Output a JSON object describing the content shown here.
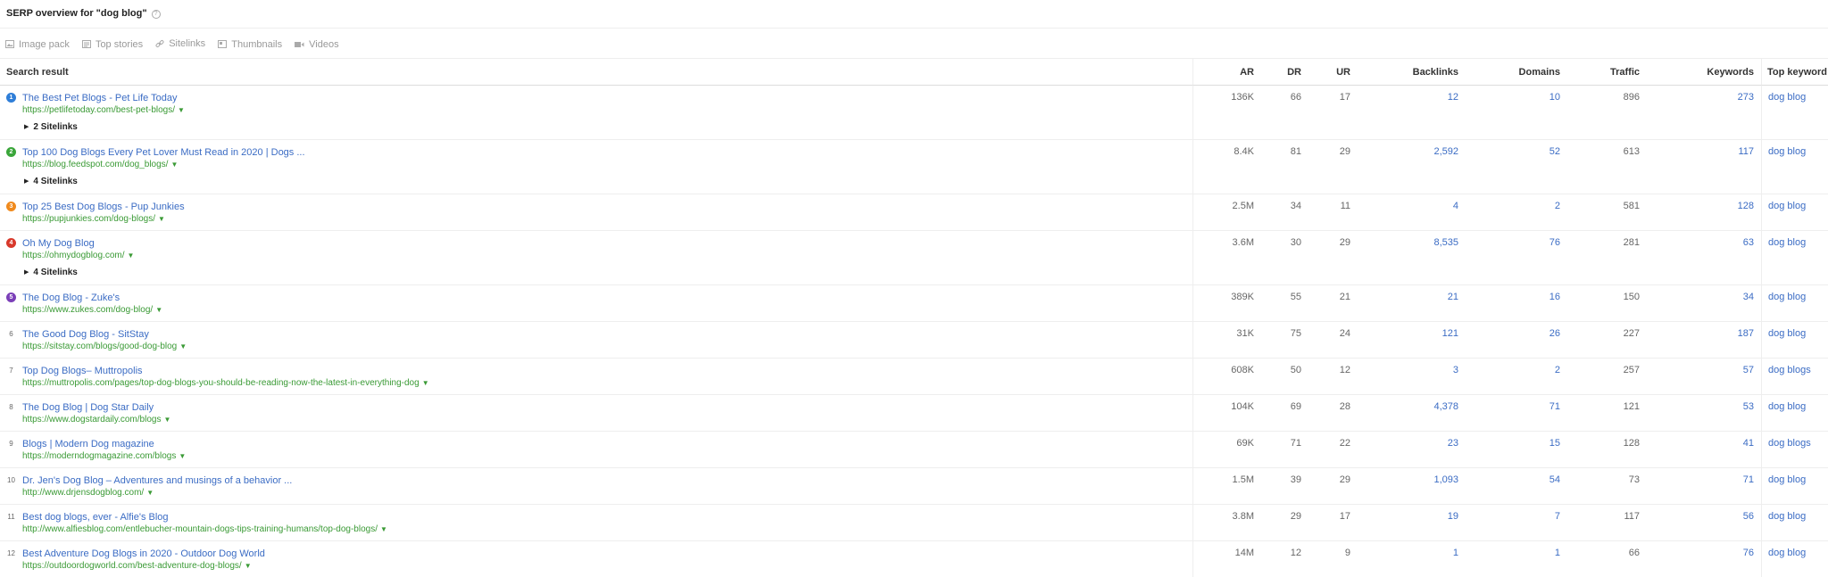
{
  "header": {
    "title": "SERP overview for \"dog blog\"",
    "help_glyph": "?"
  },
  "features": [
    {
      "label": "Image pack",
      "icon": "image-icon"
    },
    {
      "label": "Top stories",
      "icon": "news-icon"
    },
    {
      "label": "Sitelinks",
      "icon": "link-icon"
    },
    {
      "label": "Thumbnails",
      "icon": "thumbnail-icon"
    },
    {
      "label": "Videos",
      "icon": "video-icon"
    }
  ],
  "columns": {
    "result": "Search result",
    "ar": "AR",
    "dr": "DR",
    "ur": "UR",
    "backlinks": "Backlinks",
    "domains": "Domains",
    "traffic": "Traffic",
    "keywords": "Keywords",
    "top_keyword": "Top keyword"
  },
  "rows": [
    {
      "pos": "1",
      "badge_color": "#2f7ed8",
      "title": "The Best Pet Blogs - Pet Life Today",
      "url": "https://petlifetoday.com/best-pet-blogs/",
      "sitelinks": "2 Sitelinks",
      "ar": "136K",
      "dr": "66",
      "ur": "17",
      "backlinks": "12",
      "domains": "10",
      "traffic": "896",
      "keywords": "273",
      "top_keyword": "dog blog"
    },
    {
      "pos": "2",
      "badge_color": "#3aa63a",
      "title": "Top 100 Dog Blogs Every Pet Lover Must Read in 2020 | Dogs ...",
      "url": "https://blog.feedspot.com/dog_blogs/",
      "sitelinks": "4 Sitelinks",
      "ar": "8.4K",
      "dr": "81",
      "ur": "29",
      "backlinks": "2,592",
      "domains": "52",
      "traffic": "613",
      "keywords": "117",
      "top_keyword": "dog blog"
    },
    {
      "pos": "3",
      "badge_color": "#f08a1d",
      "title": "Top 25 Best Dog Blogs - Pup Junkies",
      "url": "https://pupjunkies.com/dog-blogs/",
      "sitelinks": "",
      "ar": "2.5M",
      "dr": "34",
      "ur": "11",
      "backlinks": "4",
      "domains": "2",
      "traffic": "581",
      "keywords": "128",
      "top_keyword": "dog blog"
    },
    {
      "pos": "4",
      "badge_color": "#d8392b",
      "title": "Oh My Dog Blog",
      "url": "https://ohmydogblog.com/",
      "sitelinks": "4 Sitelinks",
      "ar": "3.6M",
      "dr": "30",
      "ur": "29",
      "backlinks": "8,535",
      "domains": "76",
      "traffic": "281",
      "keywords": "63",
      "top_keyword": "dog blog"
    },
    {
      "pos": "5",
      "badge_color": "#7b3fb8",
      "title": "The Dog Blog - Zuke's",
      "url": "https://www.zukes.com/dog-blog/",
      "sitelinks": "",
      "ar": "389K",
      "dr": "55",
      "ur": "21",
      "backlinks": "21",
      "domains": "16",
      "traffic": "150",
      "keywords": "34",
      "top_keyword": "dog blog"
    },
    {
      "pos": "6",
      "badge_color": "",
      "title": "The Good Dog Blog - SitStay",
      "url": "https://sitstay.com/blogs/good-dog-blog",
      "sitelinks": "",
      "ar": "31K",
      "dr": "75",
      "ur": "24",
      "backlinks": "121",
      "domains": "26",
      "traffic": "227",
      "keywords": "187",
      "top_keyword": "dog blog"
    },
    {
      "pos": "7",
      "badge_color": "",
      "title": "Top Dog Blogs– Muttropolis",
      "url": "https://muttropolis.com/pages/top-dog-blogs-you-should-be-reading-now-the-latest-in-everything-dog",
      "sitelinks": "",
      "ar": "608K",
      "dr": "50",
      "ur": "12",
      "backlinks": "3",
      "domains": "2",
      "traffic": "257",
      "keywords": "57",
      "top_keyword": "dog blogs"
    },
    {
      "pos": "8",
      "badge_color": "",
      "title": "The Dog Blog | Dog Star Daily",
      "url": "https://www.dogstardaily.com/blogs",
      "sitelinks": "",
      "ar": "104K",
      "dr": "69",
      "ur": "28",
      "backlinks": "4,378",
      "domains": "71",
      "traffic": "121",
      "keywords": "53",
      "top_keyword": "dog blog"
    },
    {
      "pos": "9",
      "badge_color": "",
      "title": "Blogs | Modern Dog magazine",
      "url": "https://moderndogmagazine.com/blogs",
      "sitelinks": "",
      "ar": "69K",
      "dr": "71",
      "ur": "22",
      "backlinks": "23",
      "domains": "15",
      "traffic": "128",
      "keywords": "41",
      "top_keyword": "dog blogs"
    },
    {
      "pos": "10",
      "badge_color": "",
      "title": "Dr. Jen's Dog Blog – Adventures and musings of a behavior ...",
      "url": "http://www.drjensdogblog.com/",
      "sitelinks": "",
      "ar": "1.5M",
      "dr": "39",
      "ur": "29",
      "backlinks": "1,093",
      "domains": "54",
      "traffic": "73",
      "keywords": "71",
      "top_keyword": "dog blog"
    },
    {
      "pos": "11",
      "badge_color": "",
      "title": "Best dog blogs, ever - Alfie's Blog",
      "url": "http://www.alfiesblog.com/entlebucher-mountain-dogs-tips-training-humans/top-dog-blogs/",
      "sitelinks": "",
      "ar": "3.8M",
      "dr": "29",
      "ur": "17",
      "backlinks": "19",
      "domains": "7",
      "traffic": "117",
      "keywords": "56",
      "top_keyword": "dog blog"
    },
    {
      "pos": "12",
      "badge_color": "",
      "title": "Best Adventure Dog Blogs in 2020 - Outdoor Dog World",
      "url": "https://outdoordogworld.com/best-adventure-dog-blogs/",
      "sitelinks": "",
      "ar": "14M",
      "dr": "12",
      "ur": "9",
      "backlinks": "1",
      "domains": "1",
      "traffic": "66",
      "keywords": "76",
      "top_keyword": "dog blog"
    }
  ]
}
